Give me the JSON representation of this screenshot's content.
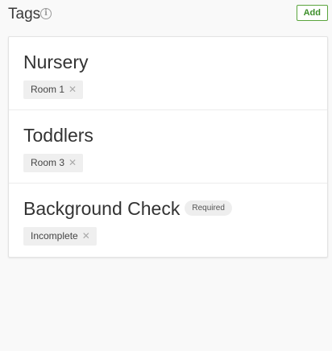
{
  "header": {
    "title": "Tags",
    "info_icon": "info-icon",
    "info_glyph": "i",
    "add_label": "Add"
  },
  "sections": [
    {
      "title": "Nursery",
      "badge": "",
      "tags": [
        {
          "label": "Room 1",
          "remove_glyph": "✕"
        }
      ]
    },
    {
      "title": "Toddlers",
      "badge": "",
      "tags": [
        {
          "label": "Room 3",
          "remove_glyph": "✕"
        }
      ]
    },
    {
      "title": "Background Check",
      "badge": "Required",
      "tags": [
        {
          "label": "Incomplete",
          "remove_glyph": "✕"
        }
      ]
    }
  ],
  "colors": {
    "accent_green": "#3d8f2a",
    "chip_bg": "#efefef",
    "page_bg": "#f9f9f9"
  }
}
